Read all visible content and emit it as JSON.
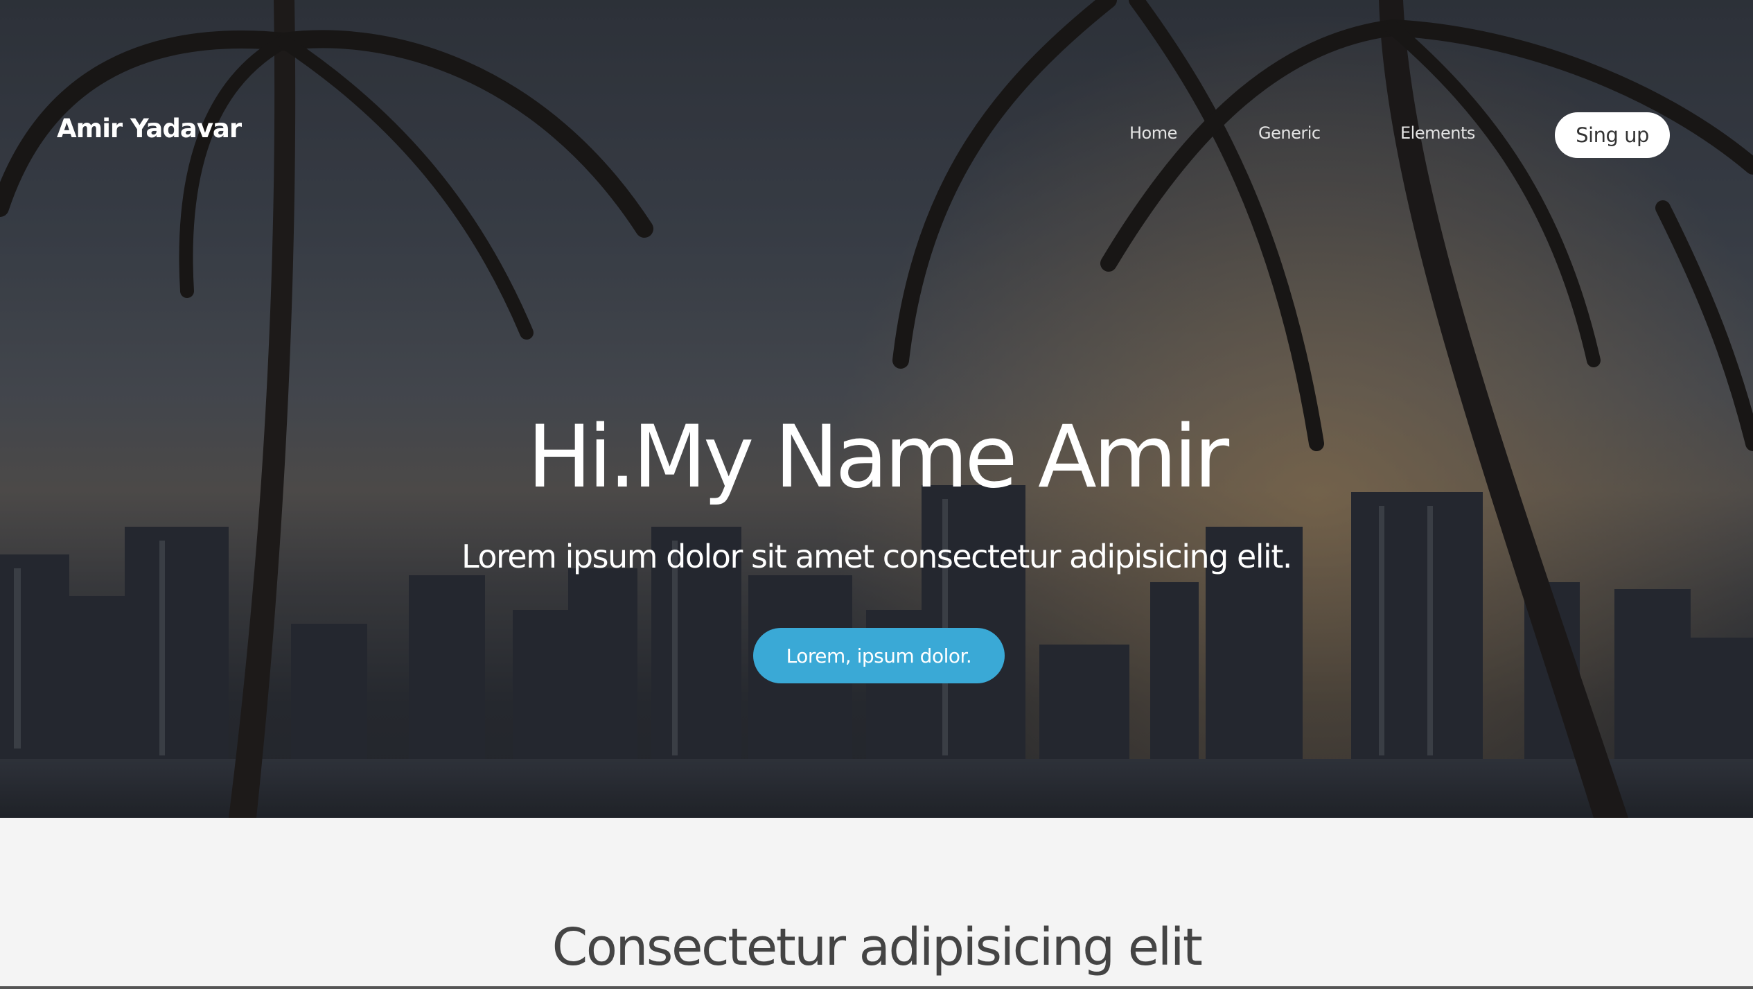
{
  "header": {
    "brand": "Amir Yadavar",
    "nav": [
      "Home",
      "Generic",
      "Elements"
    ],
    "signup_label": "Sing up"
  },
  "hero": {
    "title": "Hi.My Name Amir",
    "subtitle": "Lorem ipsum dolor sit amet consectetur adipisicing elit.",
    "cta_label": "Lorem, ipsum dolor."
  },
  "section": {
    "title": "Consectetur adipisicing elit"
  },
  "colors": {
    "accent": "#3aa9d6",
    "section_bg": "#f4f4f4",
    "section_text": "#444444"
  }
}
